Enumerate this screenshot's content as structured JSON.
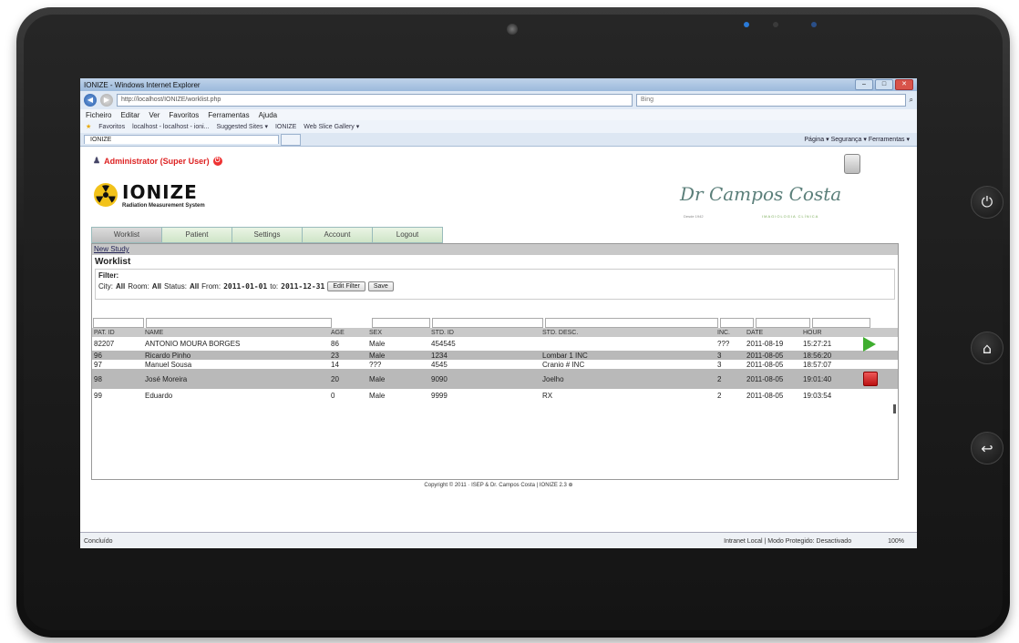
{
  "browser": {
    "window_title": "IONIZE - Windows Internet Explorer",
    "url": "http://localhost/IONIZE/worklist.php",
    "search_placeholder": "Bing",
    "menu": [
      "Ficheiro",
      "Editar",
      "Ver",
      "Favoritos",
      "Ferramentas",
      "Ajuda"
    ],
    "favorites_label": "Favoritos",
    "favorites_items": [
      "localhost - localhost - ioni...",
      "Suggested Sites ▾",
      "IONIZE",
      "Web Slice Gallery ▾"
    ],
    "tab_label": "IONIZE",
    "toolbar_items": "Página ▾  Segurança ▾  Ferramentas ▾",
    "status_left": "Concluído",
    "status_zone": "Intranet Local | Modo Protegido: Desactivado",
    "zoom": "100%"
  },
  "app": {
    "user_label": "Administrator (Super User)",
    "logo_title": "IONIZE",
    "logo_subtitle": "Radiation Measurement System",
    "clinic_signature": "Dr Campos Costa",
    "clinic_subtitle": "IMAGIOLOGIA CLÍNICA",
    "clinic_since": "Desde 1942",
    "nav_tabs": [
      "Worklist",
      "Patient",
      "Settings",
      "Account",
      "Logout"
    ],
    "active_tab": "Worklist",
    "new_study_link": "New Study",
    "section_title": "Worklist",
    "filter": {
      "label": "Filter:",
      "city_label": "City:",
      "city_value": "All",
      "room_label": "Room:",
      "room_value": "All",
      "status_label": "Status:",
      "status_value": "All",
      "from_label": "From:",
      "from_value": "2011-01-01",
      "to_label": "to:",
      "to_value": "2011-12-31",
      "edit_button": "Edit Filter",
      "save_button": "Save"
    },
    "columns": [
      "PAT. ID",
      "NAME",
      "AGE",
      "SEX",
      "STD. ID",
      "STD. DESC.",
      "INC.",
      "DATE",
      "HOUR"
    ],
    "rows": [
      {
        "pat_id": "82207",
        "name": "ANTONIO MOURA BORGES",
        "age": "86",
        "sex": "Male",
        "std_id": "454545",
        "desc": "",
        "inc": "???",
        "date": "2011-08-19",
        "hour": "15:27:21",
        "action": "play"
      },
      {
        "pat_id": "96",
        "name": "Ricardo Pinho",
        "age": "23",
        "sex": "Male",
        "std_id": "1234",
        "desc": "Lombar 1 INC",
        "inc": "3",
        "date": "2011-08-05",
        "hour": "18:56:20",
        "action": ""
      },
      {
        "pat_id": "97",
        "name": "Manuel Sousa",
        "age": "14",
        "sex": "???",
        "std_id": "4545",
        "desc": "Cranio # INC",
        "inc": "3",
        "date": "2011-08-05",
        "hour": "18:57:07",
        "action": ""
      },
      {
        "pat_id": "98",
        "name": "José Moreira",
        "age": "20",
        "sex": "Male",
        "std_id": "9090",
        "desc": "Joelho",
        "inc": "2",
        "date": "2011-08-05",
        "hour": "19:01:40",
        "action": "stop"
      },
      {
        "pat_id": "99",
        "name": "Eduardo",
        "age": "0",
        "sex": "Male",
        "std_id": "9999",
        "desc": "RX",
        "inc": "2",
        "date": "2011-08-05",
        "hour": "19:03:54",
        "action": ""
      }
    ],
    "footer": "Copyright © 2011 · ISEP & Dr. Campos Costa | IONIZE 2.3 ⊕"
  }
}
